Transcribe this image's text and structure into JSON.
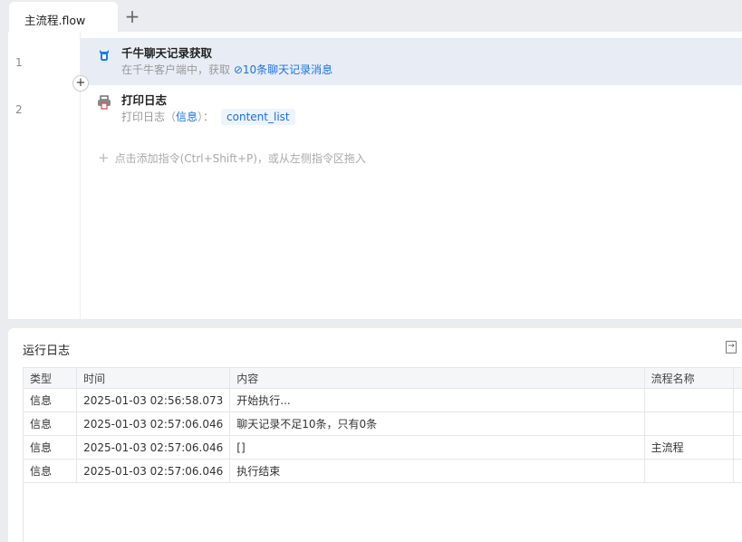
{
  "tabs": {
    "active": "主流程.flow",
    "add": "+"
  },
  "editor": {
    "lines": [
      "1",
      "2"
    ],
    "steps": [
      {
        "title": "千牛聊天记录获取",
        "sub_prefix": "在千牛客户端中，获取",
        "sub_value": "10条聊天记录消息"
      },
      {
        "title": "打印日志",
        "sub_prefix": "打印日志（",
        "sub_level": "信息",
        "sub_mid": "）：",
        "sub_var": "content_list"
      }
    ],
    "insert": "+",
    "hint": "点击添加指令(Ctrl+Shift+P)，或从左侧指令区拖入"
  },
  "log": {
    "title": "运行日志",
    "columns": [
      "类型",
      "时间",
      "内容",
      "流程名称"
    ],
    "rows": [
      [
        "信息",
        "2025-01-03 02:56:58.073",
        "开始执行...",
        ""
      ],
      [
        "信息",
        "2025-01-03 02:57:06.046",
        "聊天记录不足10条，只有0条",
        ""
      ],
      [
        "信息",
        "2025-01-03 02:57:06.046",
        "[]",
        "主流程"
      ],
      [
        "信息",
        "2025-01-03 02:57:06.046",
        "执行结束",
        ""
      ]
    ]
  }
}
